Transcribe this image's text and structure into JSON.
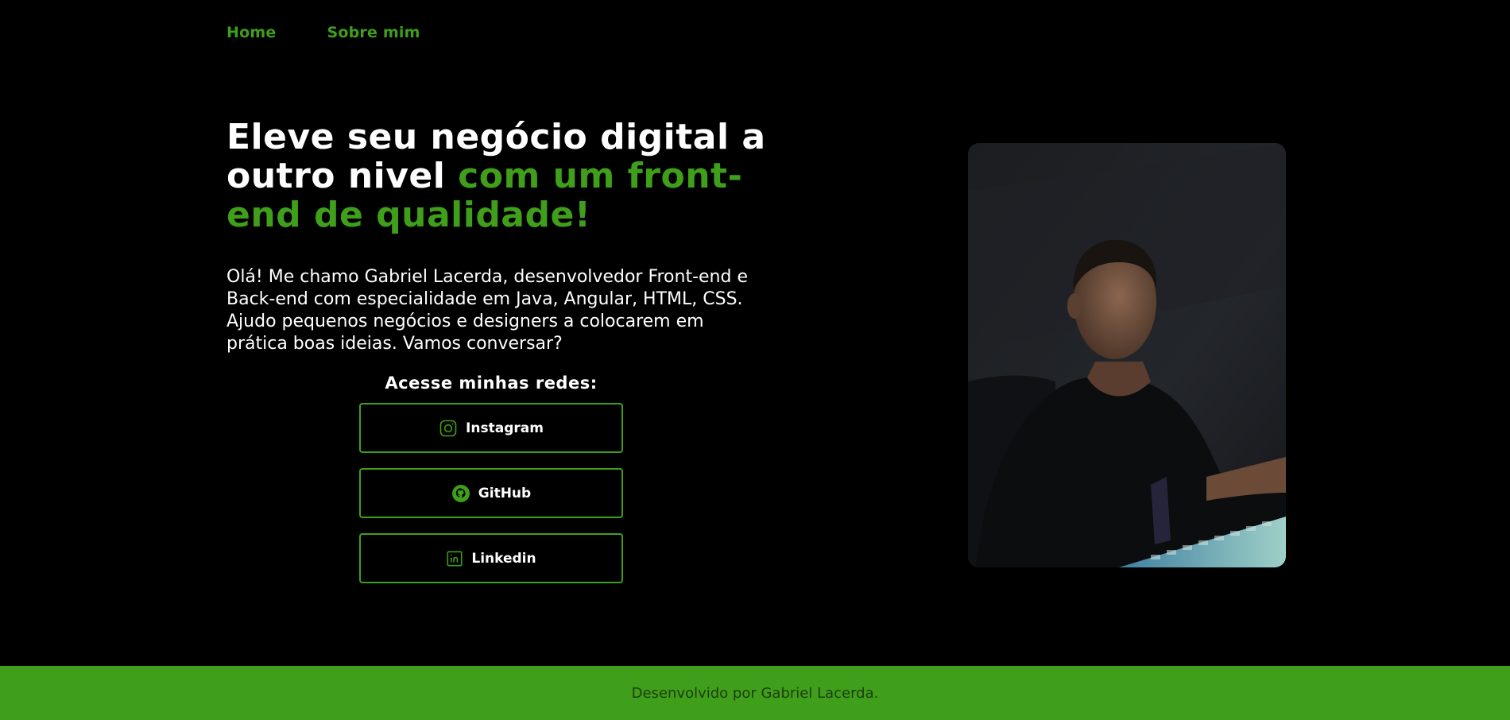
{
  "nav": {
    "items": [
      {
        "label": "Home"
      },
      {
        "label": "Sobre mim"
      }
    ]
  },
  "hero": {
    "headline_white": "Eleve seu negócio digital a outro nivel",
    "headline_green": "com um front-end de qualidade!",
    "intro": "Olá! Me chamo Gabriel Lacerda, desenvolvedor Front-end e Back-end com especialidade em Java, Angular, HTML, CSS. Ajudo pequenos negócios e designers a colocarem em prática boas ideias. Vamos conversar?"
  },
  "socials": {
    "title": "Acesse minhas redes:",
    "buttons": [
      {
        "label": "Instagram",
        "icon": "instagram-icon"
      },
      {
        "label": "GitHub",
        "icon": "github-icon"
      },
      {
        "label": "Linkedin",
        "icon": "linkedin-icon"
      }
    ]
  },
  "footer": {
    "text": "Desenvolvido por Gabriel Lacerda."
  },
  "colors": {
    "background": "#000000",
    "accent": "#3f9f1a",
    "text": "#ffffff"
  }
}
